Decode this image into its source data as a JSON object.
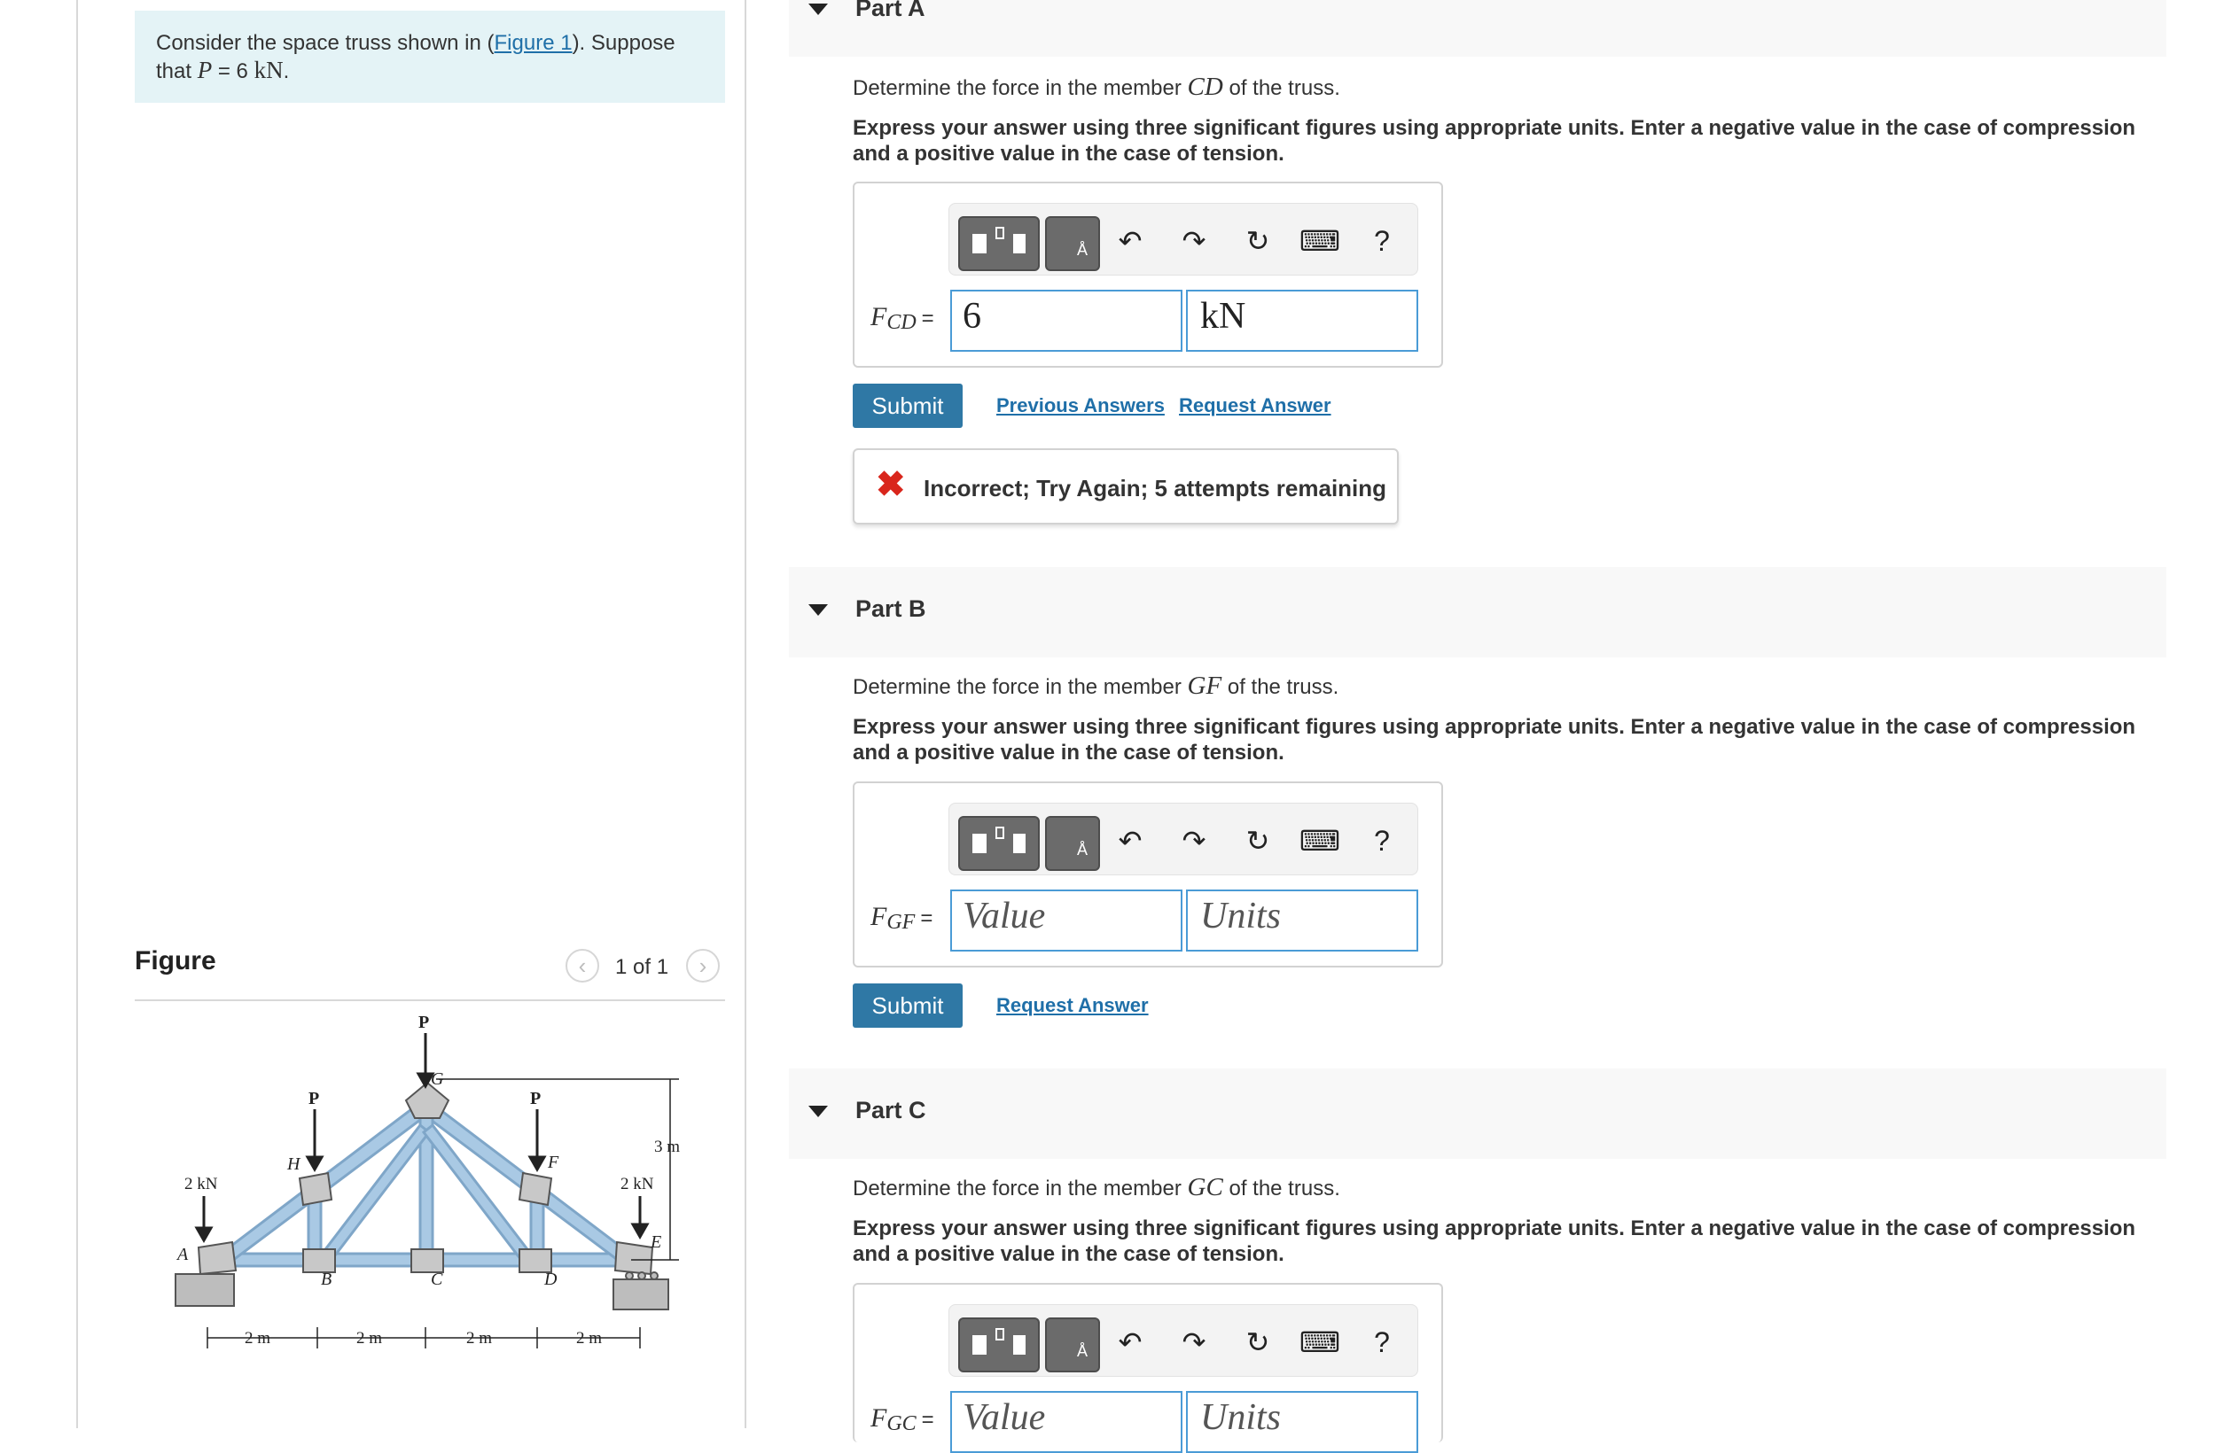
{
  "problem": {
    "text_before": "Consider the space truss shown in (",
    "link": "Figure 1",
    "text_after": "). Suppose",
    "line2_prefix": "that ",
    "var": "P",
    "eq": " = 6 ",
    "unit": "kN",
    "end": "."
  },
  "figure": {
    "title": "Figure",
    "counter": "1 of 1",
    "labels": {
      "P": "P",
      "G": "G",
      "H": "H",
      "F": "F",
      "A": "A",
      "B": "B",
      "C": "C",
      "D": "D",
      "E": "E",
      "load_left": "2 kN",
      "load_right": "2 kN",
      "height": "3 m",
      "span": "2 m"
    }
  },
  "parts": [
    {
      "label": "Part A",
      "question_prefix": "Determine the force in the member ",
      "member": "CD",
      "question_suffix": " of the truss.",
      "instructions": "Express your answer using three significant figures using appropriate units. Enter a negative value in the case of compression and a positive value in the case of tension.",
      "var_main": "F",
      "var_sub": "CD",
      "value": "6",
      "units": "kN",
      "submit": "Submit",
      "previous_answers": "Previous Answers",
      "request_answer": "Request Answer",
      "feedback": "Incorrect; Try Again; 5 attempts remaining"
    },
    {
      "label": "Part B",
      "question_prefix": "Determine the force in the member ",
      "member": "GF",
      "question_suffix": " of the truss.",
      "instructions": "Express your answer using three significant figures using appropriate units. Enter a negative value in the case of compression and a positive value in the case of tension.",
      "var_main": "F",
      "var_sub": "GF",
      "value_placeholder": "Value",
      "units_placeholder": "Units",
      "submit": "Submit",
      "request_answer": "Request Answer"
    },
    {
      "label": "Part C",
      "question_prefix": "Determine the force in the member ",
      "member": "GC",
      "question_suffix": " of the truss.",
      "instructions": "Express your answer using three significant figures using appropriate units. Enter a negative value in the case of compression and a positive value in the case of tension.",
      "var_main": "F",
      "var_sub": "GC",
      "value_placeholder": "Value",
      "units_placeholder": "Units"
    }
  ],
  "toolbar": {
    "undo": "↶",
    "redo": "↷",
    "reset": "↻",
    "keyboard": "⌨",
    "help": "?",
    "units_tpl": "Å",
    "icons": [
      "templates-icon",
      "units-icon",
      "undo-icon",
      "redo-icon",
      "reset-icon",
      "keyboard-icon",
      "help-icon"
    ]
  },
  "colors": {
    "accent": "#2f78a5",
    "link": "#1f6fa8",
    "error": "#d9261c",
    "problem_bg": "#e4f3f6",
    "input_border": "#4a9bd6",
    "truss_member": "#a9c9e4"
  }
}
